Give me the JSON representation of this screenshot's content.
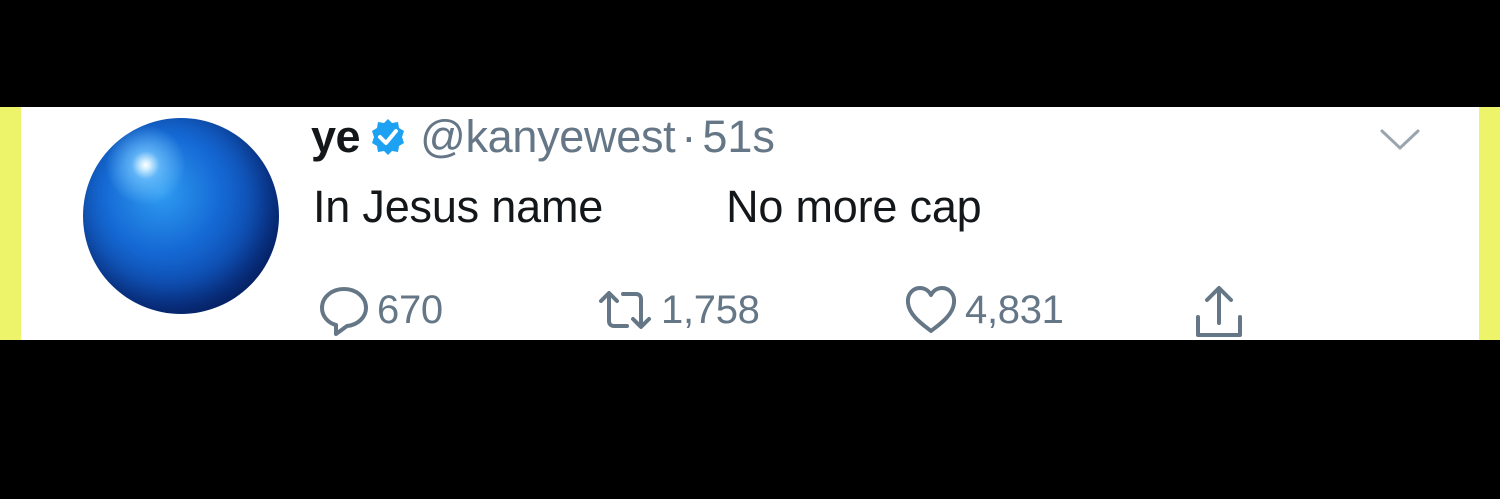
{
  "tweet": {
    "display_name": "ye",
    "handle": "@kanyewest",
    "separator": "·",
    "time": "51s",
    "text": "In Jesus name          No more cap",
    "verified": true,
    "avatar_icon": "blue-orb-avatar"
  },
  "actions": {
    "reply_count": "670",
    "retweet_count": "1,758",
    "like_count": "4,831"
  },
  "icons": {
    "verified": "verified-badge-icon",
    "caret": "chevron-down-icon",
    "reply": "reply-icon",
    "retweet": "retweet-icon",
    "like": "heart-icon",
    "share": "share-icon"
  },
  "colors": {
    "verified_blue": "#1da1f2",
    "secondary_text": "#657786",
    "primary_text": "#14171a",
    "side_highlight": "#eef46a",
    "background": "#000000"
  }
}
